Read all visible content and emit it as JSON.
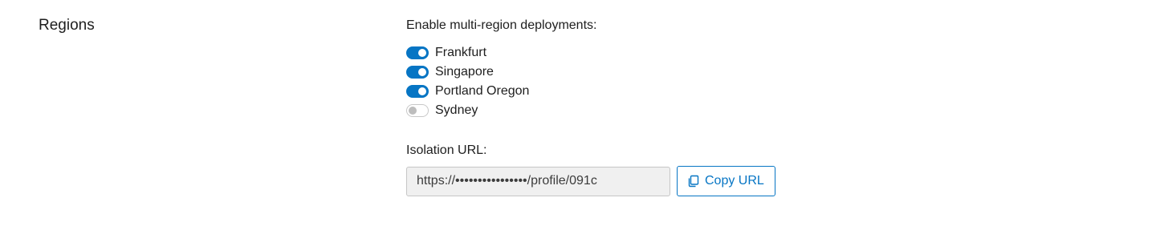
{
  "section": {
    "title": "Regions"
  },
  "regions": {
    "heading": "Enable multi-region deployments:",
    "items": [
      {
        "name": "Frankfurt",
        "enabled": true
      },
      {
        "name": "Singapore",
        "enabled": true
      },
      {
        "name": "Portland Oregon",
        "enabled": true
      },
      {
        "name": "Sydney",
        "enabled": false
      }
    ]
  },
  "isolation": {
    "label": "Isolation URL:",
    "url_value": "https://••••••••••••••••/profile/091c",
    "copy_label": "Copy URL",
    "copy_icon": "copy-icon"
  },
  "colors": {
    "accent": "#0675c4",
    "toggle_off_border": "#c8c8c8",
    "input_background": "#f0f0f0"
  }
}
